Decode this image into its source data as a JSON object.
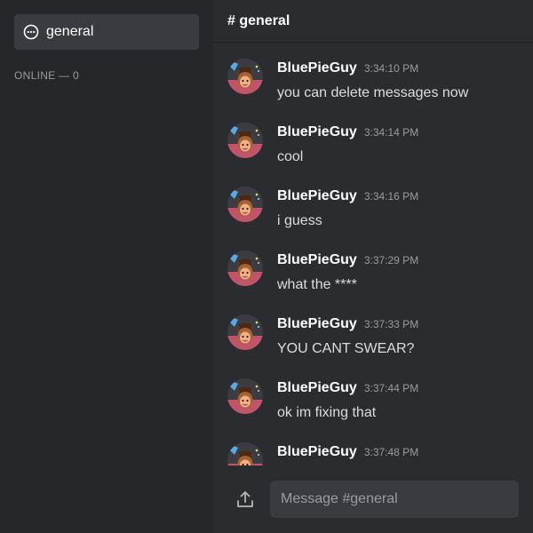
{
  "sidebar": {
    "channel": {
      "name": "general",
      "icon": "chat-bubble-icon"
    },
    "online_label": "ONLINE — 0"
  },
  "header": {
    "title": "# general"
  },
  "messages": [
    {
      "author": "BluePieGuy",
      "time": "3:34:10 PM",
      "text": "you can delete messages now"
    },
    {
      "author": "BluePieGuy",
      "time": "3:34:14 PM",
      "text": "cool"
    },
    {
      "author": "BluePieGuy",
      "time": "3:34:16 PM",
      "text": "i guess"
    },
    {
      "author": "BluePieGuy",
      "time": "3:37:29 PM",
      "text": "what the ****"
    },
    {
      "author": "BluePieGuy",
      "time": "3:37:33 PM",
      "text": "YOU CANT SWEAR?"
    },
    {
      "author": "BluePieGuy",
      "time": "3:37:44 PM",
      "text": "ok im fixing that"
    },
    {
      "author": "BluePieGuy",
      "time": "3:37:48 PM",
      "text": ""
    }
  ],
  "composer": {
    "placeholder": "Message #general",
    "value": "",
    "upload_icon": "upload-icon"
  },
  "colors": {
    "sidebar_bg": "#26272b",
    "main_bg": "#2b2c30",
    "active_channel_bg": "#3a3b40",
    "input_bg": "#3a3b40",
    "muted_text": "#9a9ba1"
  }
}
